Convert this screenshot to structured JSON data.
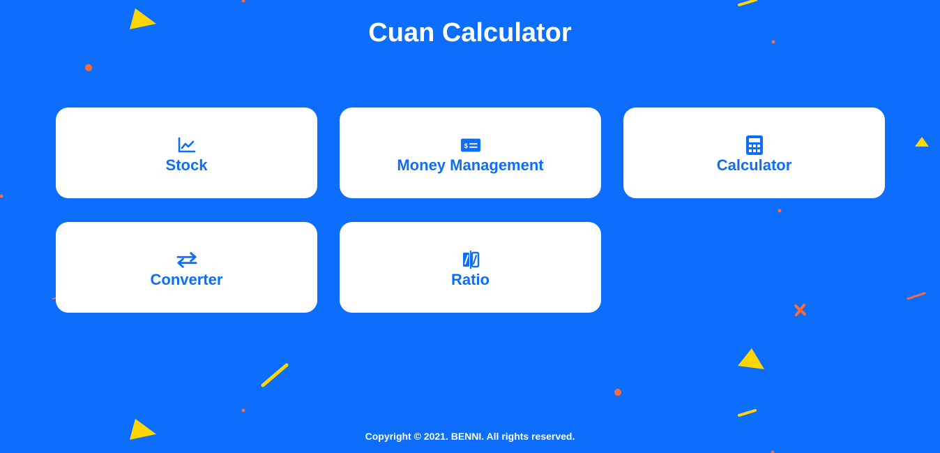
{
  "app": {
    "title": "Cuan Calculator",
    "footer": "Copyright © 2021. BENNI. All rights reserved."
  },
  "menu": {
    "items": [
      {
        "label": "Stock",
        "icon": "chart-line-icon"
      },
      {
        "label": "Money Management",
        "icon": "money-check-icon"
      },
      {
        "label": "Calculator",
        "icon": "calculator-icon"
      },
      {
        "label": "Converter",
        "icon": "exchange-arrows-icon"
      },
      {
        "label": "Ratio",
        "icon": "ratio-icon"
      }
    ]
  },
  "colors": {
    "background": "#0d6efd",
    "card": "#ffffff",
    "accent": "#0d6efd",
    "confetti_yellow": "#ffd600",
    "confetti_orange": "#ff6b35"
  }
}
